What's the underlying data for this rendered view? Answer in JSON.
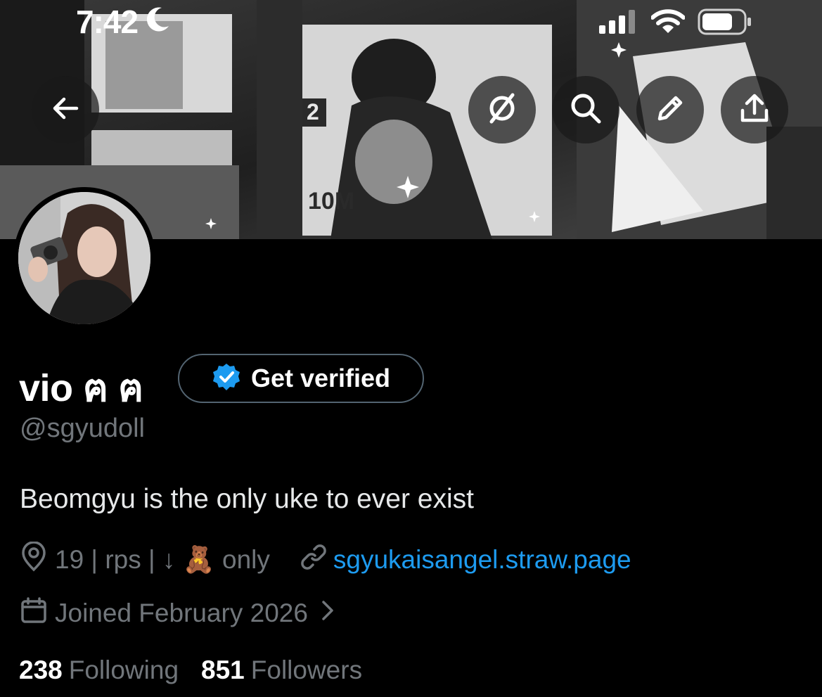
{
  "status_bar": {
    "time": "7:42",
    "icons": [
      "moon-icon",
      "cellular-signal-icon",
      "wifi-icon",
      "battery-icon"
    ]
  },
  "header": {
    "buttons": [
      "back-arrow-icon",
      "grok-icon",
      "search-icon",
      "edit-pencil-icon",
      "share-icon"
    ],
    "banner_text": [
      "2",
      "10M"
    ]
  },
  "profile": {
    "display_name": "vio ฅ ฅ",
    "verify_label": "Get verified",
    "handle": "@sgyudoll",
    "bio": "Beomgyu is the only uke to ever exist",
    "location": "19 | rps | ↓ 🧸  only",
    "website": "sgyukaisangel.straw.page",
    "joined": "Joined February 2026",
    "following_count": "238",
    "following_label": "Following",
    "followers_count": "851",
    "followers_label": "Followers"
  },
  "colors": {
    "background": "#000000",
    "primary_text": "#e7e9ea",
    "secondary_text": "#71767b",
    "link": "#1d9bf0",
    "verified_badge": "#1d9bf0",
    "pill_border": "#536471"
  }
}
